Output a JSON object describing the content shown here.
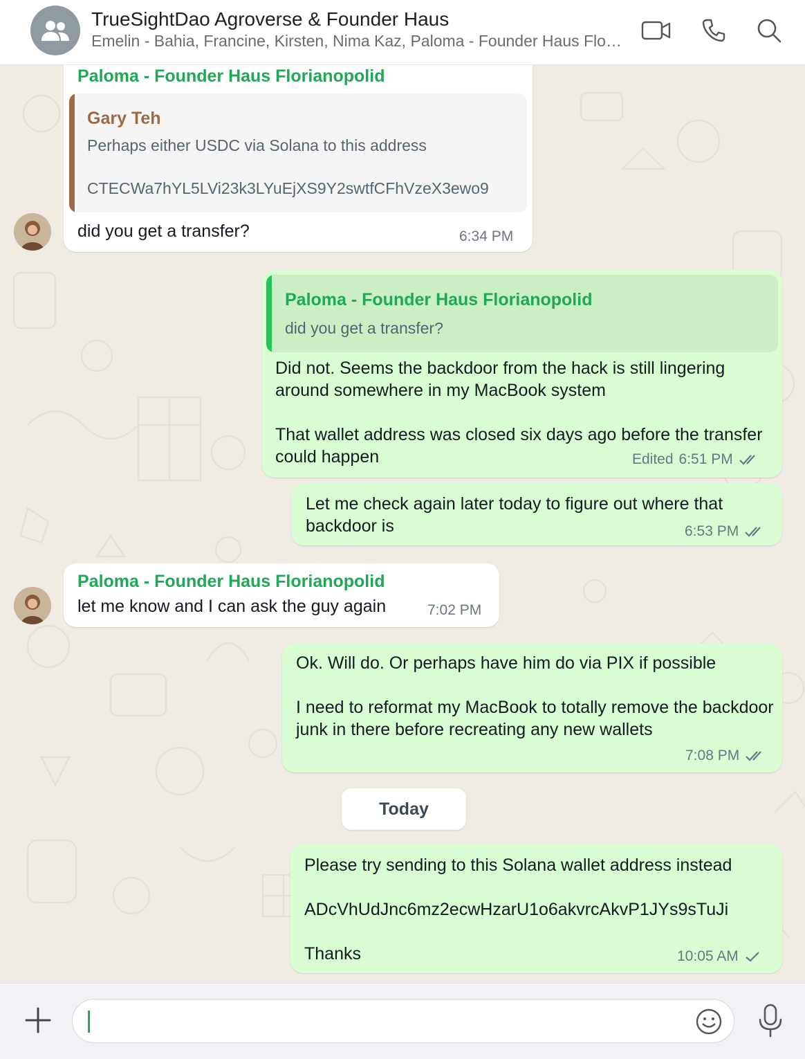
{
  "header": {
    "title": "TrueSightDao Agroverse & Founder Haus",
    "subtitle": "Emelin - Bahia, Francine, Kirsten, Nima Kaz, Paloma - Founder Haus Florianopolid, You",
    "icons": [
      "video-call-icon",
      "phone-icon",
      "search-icon"
    ]
  },
  "messages": {
    "m1": {
      "sender": "Paloma - Founder Haus Florianopolid",
      "quote_sender": "Gary Teh",
      "quote_line1": "Perhaps either USDC via Solana to this address",
      "quote_line2": "CTECWa7hYL5LVi23k3LYuEjXS9Y2swtfCFhVzeX3ewo9",
      "text": "did you get a transfer?",
      "time": "6:34 PM"
    },
    "m2": {
      "quote_sender": "Paloma - Founder Haus Florianopolid",
      "quote_text": "did you get a transfer?",
      "text": "Did not. Seems the backdoor from the hack is still lingering around somewhere in my MacBook system\n\nThat wallet address was closed six days ago before the transfer could happen",
      "edited": "Edited",
      "time": "6:51 PM"
    },
    "m3": {
      "text": "Let me check again later today to figure out where that backdoor is",
      "time": "6:53 PM"
    },
    "m4": {
      "sender": "Paloma - Founder Haus Florianopolid",
      "text": "let me know and I can ask the guy again",
      "time": "7:02 PM"
    },
    "m5": {
      "text": "Ok. Will do. Or perhaps have him do via PIX if possible\n\nI need to reformat my MacBook to totally remove the backdoor junk in there before recreating any new wallets",
      "time": "7:08 PM"
    },
    "divider": "Today",
    "m6": {
      "text": "Please try sending to this Solana wallet address instead\n\nADcVhUdJnc6mz2ecwHzarU1o6akvrcAkvP1JYs9sTuJi\n\nThanks",
      "time": "10:05 AM"
    }
  },
  "composer": {
    "placeholder": "",
    "value": ""
  },
  "colors": {
    "sender_green": "#1fa855",
    "quote_brown": "#9c6b45",
    "outgoing_bubble": "#d9fdd3",
    "incoming_bubble": "#ffffff",
    "chat_background": "#efeae2"
  }
}
